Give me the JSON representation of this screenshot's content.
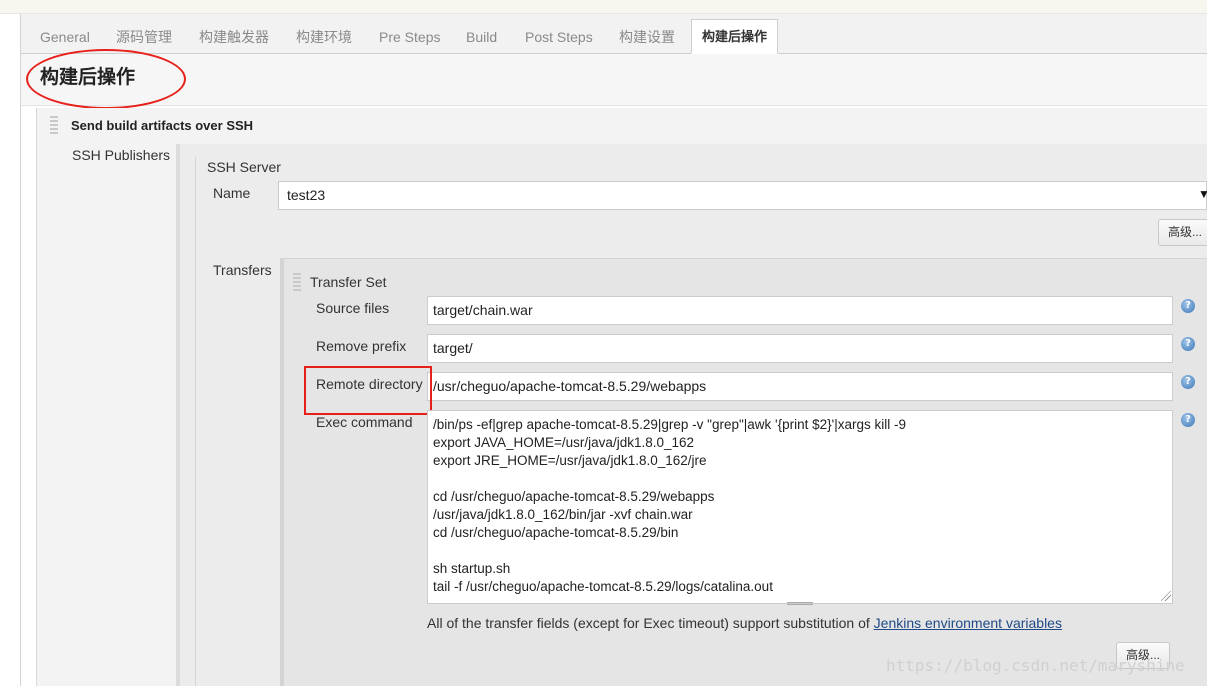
{
  "tabs": [
    {
      "label": "General"
    },
    {
      "label": "源码管理"
    },
    {
      "label": "构建触发器"
    },
    {
      "label": "构建环境"
    },
    {
      "label": "Pre Steps"
    },
    {
      "label": "Build"
    },
    {
      "label": "Post Steps"
    },
    {
      "label": "构建设置"
    },
    {
      "label": "构建后操作",
      "active": true
    }
  ],
  "section": {
    "title": "构建后操作"
  },
  "publisher": {
    "title": "Send build artifacts over SSH",
    "publishers_label": "SSH Publishers",
    "server_label": "SSH Server",
    "name_label": "Name",
    "name_value": "test23",
    "advanced_label": "高级..."
  },
  "transfers": {
    "label": "Transfers",
    "set_title": "Transfer Set",
    "source_files_label": "Source files",
    "source_files_value": "target/chain.war",
    "remove_prefix_label": "Remove prefix",
    "remove_prefix_value": "target/",
    "remote_directory_label": "Remote directory",
    "remote_directory_value": "/usr/cheguo/apache-tomcat-8.5.29/webapps",
    "exec_command_label": "Exec command",
    "exec_command_lines": [
      "/bin/ps -ef|grep apache-tomcat-8.5.29|grep -v \"grep\"|awk '{print $2}'|xargs kill -9",
      "export JAVA_HOME=/usr/java/jdk1.8.0_162",
      "export JRE_HOME=/usr/java/jdk1.8.0_162/jre",
      "",
      "cd /usr/cheguo/apache-tomcat-8.5.29/webapps",
      "/usr/java/jdk1.8.0_162/bin/jar -xvf chain.war",
      "cd /usr/cheguo/apache-tomcat-8.5.29/bin",
      "",
      "sh startup.sh",
      "tail -f /usr/cheguo/apache-tomcat-8.5.29/logs/catalina.out"
    ],
    "hint_text": "All of the transfer fields (except for Exec timeout) support substitution of ",
    "hint_link": "Jenkins environment variables",
    "advanced_label": "高级..."
  },
  "help_icon_glyph": "?",
  "select_arrow_glyph": "▼",
  "watermark": "https://blog.csdn.net/maryshine",
  "colors": {
    "annotation_red": "#e8201a",
    "link": "#204a87"
  }
}
